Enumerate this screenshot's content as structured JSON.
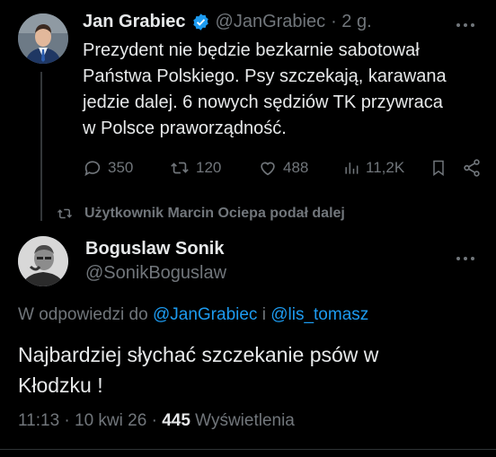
{
  "first_tweet": {
    "author_name": "Jan Grabiec",
    "handle": "@JanGrabiec",
    "time": "· 2 g.",
    "lines": [
      "Prezydent nie będzie bezkarnie sabotował",
      "Państwa Polskiego. Psy szczekają, karawana",
      "jedzie dalej. 6 nowych sędziów TK przywraca",
      "w Polsce praworządność."
    ],
    "metrics": {
      "replies": "350",
      "reposts": "120",
      "likes": "488",
      "views": "11,2K"
    }
  },
  "repost_banner": "Użytkownik Marcin Ociepa podał dalej",
  "second_tweet": {
    "author_name": "Boguslaw Sonik",
    "handle": "@SonikBoguslaw",
    "reply_prefix": "W odpowiedzi do",
    "reply_to_1": "@JanGrabiec",
    "reply_and": "i",
    "reply_to_2": "@lis_tomasz",
    "lines": [
      "Najbardziej słychać szczekanie psów w",
      "Kłodzku !"
    ],
    "time_date": "11:13 · 10 kwi 26 ·",
    "views_count": "445",
    "views_label": "Wyświetlenia"
  },
  "colors": {
    "background": "#000000",
    "text": "#e7e9ea",
    "muted": "#71767b",
    "link": "#1d9bf0",
    "verified": "#1d9bf0"
  }
}
